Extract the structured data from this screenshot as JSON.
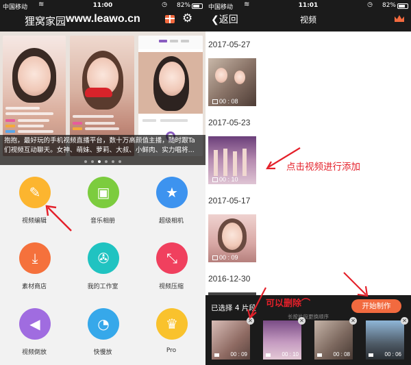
{
  "status_left": {
    "carrier": "中国移动",
    "time": "11:00",
    "battery": "82%"
  },
  "status_right": {
    "carrier": "中国移动",
    "time": "11:01",
    "battery": "82%"
  },
  "left_app": {
    "brand": "狸窝家园",
    "watermark": "www.leawo.cn",
    "banner_caption_line1": "抱抱，最好玩的手机视频直播平台，数十万高颜值主播，随时跟Ta",
    "banner_caption_line2": "们视频互动聊天。女神、萌妹、萝莉、大叔、小鲜肉、实力唱将...",
    "banner_page_count": 6,
    "banner_active_page": 2,
    "tiles": [
      {
        "label": "视频编辑",
        "icon": "pencil-icon",
        "color": "#fcb52f"
      },
      {
        "label": "音乐相册",
        "icon": "image-icon",
        "color": "#7ccc3e"
      },
      {
        "label": "超级相机",
        "icon": "camera-star-icon",
        "color": "#3d93ef"
      },
      {
        "label": "素材商店",
        "icon": "download-icon",
        "color": "#f5713c"
      },
      {
        "label": "我的工作室",
        "icon": "film-reel-icon",
        "color": "#20c3c1"
      },
      {
        "label": "视频压缩",
        "icon": "compress-icon",
        "color": "#f0405e"
      },
      {
        "label": "视频倒放",
        "icon": "reverse-play-icon",
        "color": "#a06ce0"
      },
      {
        "label": "快慢放",
        "icon": "speedometer-icon",
        "color": "#36a8ea"
      },
      {
        "label": "Pro",
        "icon": "crown-icon",
        "color": "#f9c22d"
      }
    ]
  },
  "right_app": {
    "back_label": "返回",
    "title": "视频",
    "sections": [
      {
        "date": "2017-05-27",
        "duration": "00 : 08"
      },
      {
        "date": "2017-05-23",
        "duration": "00 : 10"
      },
      {
        "date": "2017-05-17",
        "duration": "00 : 09"
      },
      {
        "date": "2016-12-30",
        "duration": ""
      }
    ],
    "hint": "点击视频进行添加",
    "delete_hint": "可以删除",
    "selected_text": "已选择 4 片段",
    "drag_hint": "长按片段更换顺序",
    "start_button": "开始制作",
    "strip": [
      {
        "duration": "00 : 09"
      },
      {
        "duration": "00 : 10"
      },
      {
        "duration": "00 : 08"
      },
      {
        "duration": "00 : 06"
      }
    ]
  },
  "colors": {
    "accent": "#f26a3f",
    "annotation_red": "#e4202a",
    "topbar": "#1b1b1b"
  }
}
